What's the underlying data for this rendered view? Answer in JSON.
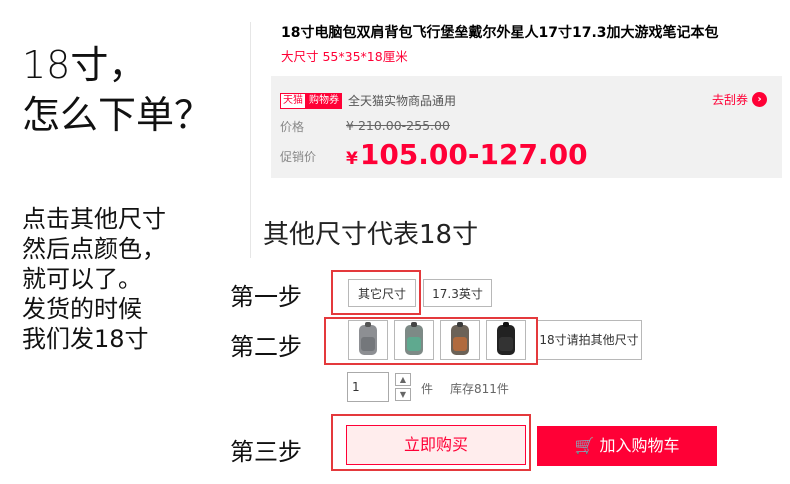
{
  "annotation": {
    "big_question_line1": "18寸，",
    "big_question_line2": "怎么下单？",
    "help_lines": [
      "点击其他尺寸",
      "然后点颜色，",
      "就可以了。",
      "发货的时候",
      "我们发18寸"
    ],
    "size_note": "其他尺寸代表18寸",
    "steps": [
      "第一步",
      "第二步",
      "第三步"
    ]
  },
  "product": {
    "title": "18寸电脑包双肩背包飞行堡垒戴尔外星人17寸17.3加大游戏笔记本包",
    "subtitle": "大尺寸 55*35*18厘米"
  },
  "coupon": {
    "tag_tmall": "天猫",
    "tag_coupon": "购物券",
    "text": "全天猫实物商品通用",
    "action": "去刮券",
    "action_icon": "chevron-right-icon"
  },
  "price": {
    "label": "价格",
    "currency": "¥",
    "original": "210.00-255.00",
    "promo_label": "促销价",
    "promo": "105.00-127.00"
  },
  "sizes": {
    "options": [
      "其它尺寸",
      "17.3英寸",
      "18寸请拍其他尺寸"
    ],
    "selected": "其它尺寸"
  },
  "colors": {
    "swatches": [
      "grey",
      "grey-green",
      "brown",
      "black"
    ]
  },
  "quantity": {
    "value": "1",
    "unit": "件",
    "stock": "库存811件"
  },
  "buttons": {
    "buy_now": "立即购买",
    "add_to_cart": "加入购物车"
  },
  "colors_theme": {
    "accent": "#ff0036",
    "annotation_box": "#e4393c"
  }
}
